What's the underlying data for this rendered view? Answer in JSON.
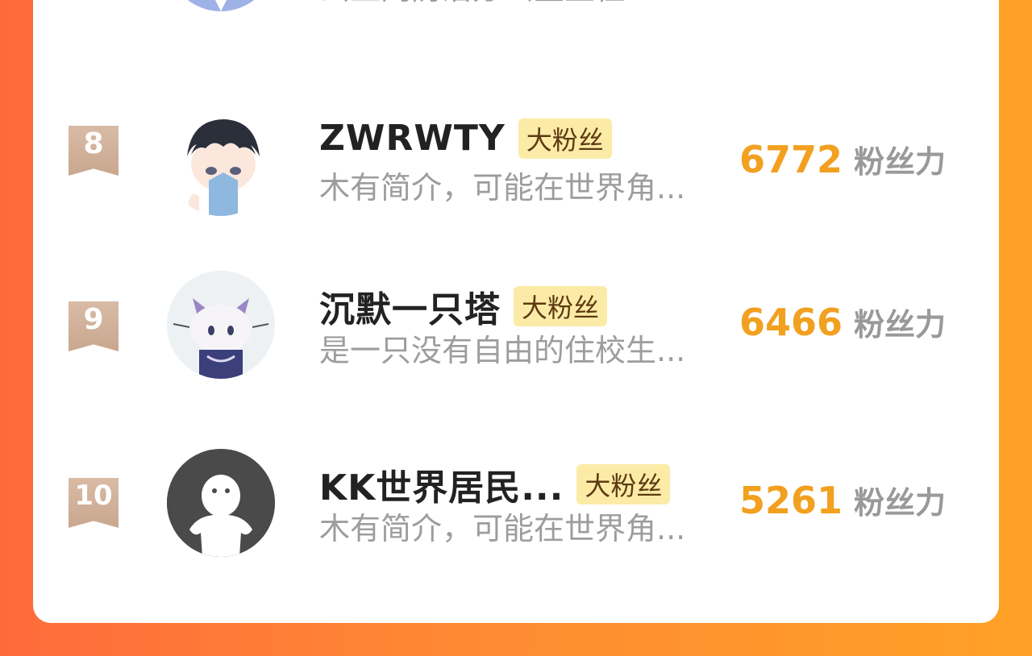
{
  "top_row": {
    "bio": "云上网防治办公室主任"
  },
  "entries": [
    {
      "rank": "8",
      "name": "ZWRWTY",
      "badge": "大粉丝",
      "bio": "木有简介，可能在世界角...",
      "score": "6772",
      "unit": "粉丝力"
    },
    {
      "rank": "9",
      "name": "沉默一只塔",
      "badge": "大粉丝",
      "bio": "是一只没有自由的住校生...",
      "score": "6466",
      "unit": "粉丝力"
    },
    {
      "rank": "10",
      "name": "KK世界居民...",
      "badge": "大粉丝",
      "bio": "木有简介，可能在世界角...",
      "score": "5261",
      "unit": "粉丝力"
    }
  ]
}
